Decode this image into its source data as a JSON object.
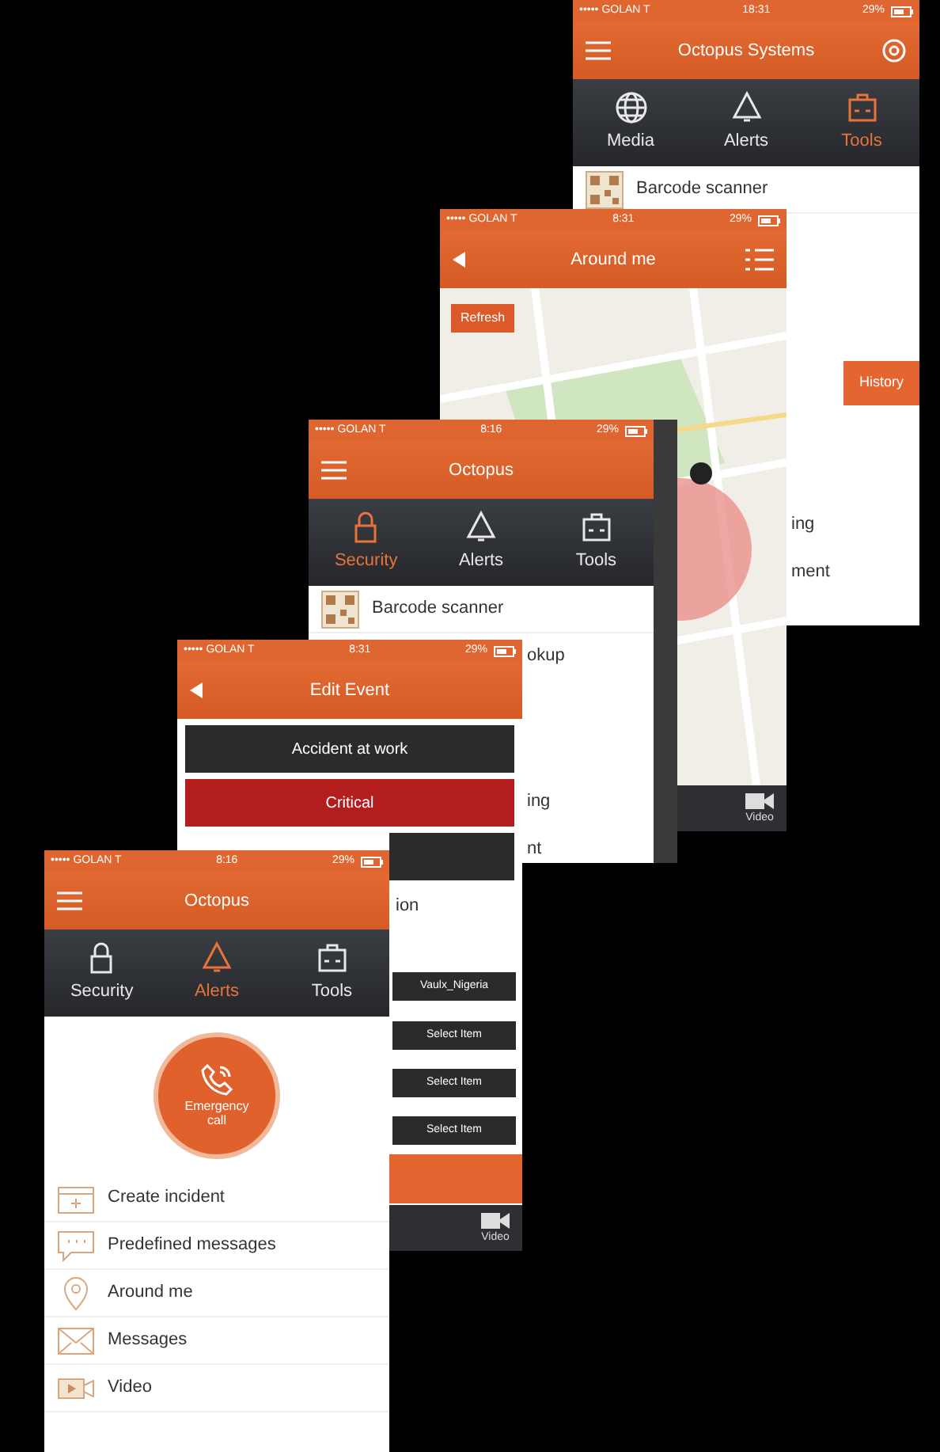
{
  "screens": [
    {
      "kind": "tools",
      "status": {
        "carrier": "••••• GOLAN T",
        "time": "18:31",
        "battery": "29%"
      },
      "header": {
        "title": "Octopus Systems"
      },
      "tabs": [
        {
          "label": "Media",
          "selected": false
        },
        {
          "label": "Alerts",
          "selected": false
        },
        {
          "label": "Tools",
          "selected": true
        }
      ],
      "rows": [
        {
          "label": "Barcode scanner"
        }
      ],
      "fragments": [
        {
          "kind": "button",
          "label": "History"
        },
        {
          "kind": "text",
          "label": "ing"
        },
        {
          "kind": "text",
          "label": "ment"
        }
      ]
    },
    {
      "kind": "map",
      "status": {
        "carrier": "••••• GOLAN T",
        "time": "8:31",
        "battery": "29%"
      },
      "header": {
        "title": "Around me"
      },
      "map": {
        "refresh": "Refresh"
      },
      "bottom_tabs": [
        {
          "label": "Video"
        }
      ]
    },
    {
      "kind": "tools",
      "status": {
        "carrier": "••••• GOLAN T",
        "time": "8:16",
        "battery": "29%"
      },
      "header": {
        "title": "Octopus"
      },
      "tabs": [
        {
          "label": "Security",
          "selected": true
        },
        {
          "label": "Alerts",
          "selected": false
        },
        {
          "label": "Tools",
          "selected": false
        }
      ],
      "rows": [
        {
          "label": "Barcode scanner"
        }
      ],
      "fragments": [
        {
          "kind": "text",
          "label": "okup"
        },
        {
          "kind": "text",
          "label": "ing"
        },
        {
          "kind": "text",
          "label": "nt"
        }
      ]
    },
    {
      "kind": "form",
      "status": {
        "carrier": "••••• GOLAN T",
        "time": "8:31",
        "battery": "29%"
      },
      "header": {
        "title": "Edit Event"
      },
      "buttons": [
        {
          "kind": "dark",
          "label": "Accident at work"
        },
        {
          "kind": "critical",
          "label": "Critical"
        },
        {
          "kind": "dark"
        }
      ],
      "fragments": [
        {
          "kind": "text",
          "label": "ion"
        },
        {
          "kind": "select",
          "label": "Vaulx_Nigeria"
        },
        {
          "kind": "select",
          "label": "Select Item"
        },
        {
          "kind": "select",
          "label": "Select Item"
        },
        {
          "kind": "select",
          "label": "Select Item"
        },
        {
          "kind": "bar"
        }
      ],
      "bottom_tabs": [
        {
          "label": "Video"
        }
      ]
    },
    {
      "kind": "alerts",
      "status": {
        "carrier": "••••• GOLAN T",
        "time": "8:16",
        "battery": "29%"
      },
      "header": {
        "title": "Octopus"
      },
      "tabs": [
        {
          "label": "Security",
          "selected": false
        },
        {
          "label": "Alerts",
          "selected": true
        },
        {
          "label": "Tools",
          "selected": false
        }
      ],
      "emergency": {
        "label": "Emergency call"
      },
      "rows": [
        {
          "label": "Create incident"
        },
        {
          "label": "Predefined messages"
        },
        {
          "label": "Around me"
        },
        {
          "label": "Messages"
        },
        {
          "label": "Video"
        }
      ]
    }
  ]
}
